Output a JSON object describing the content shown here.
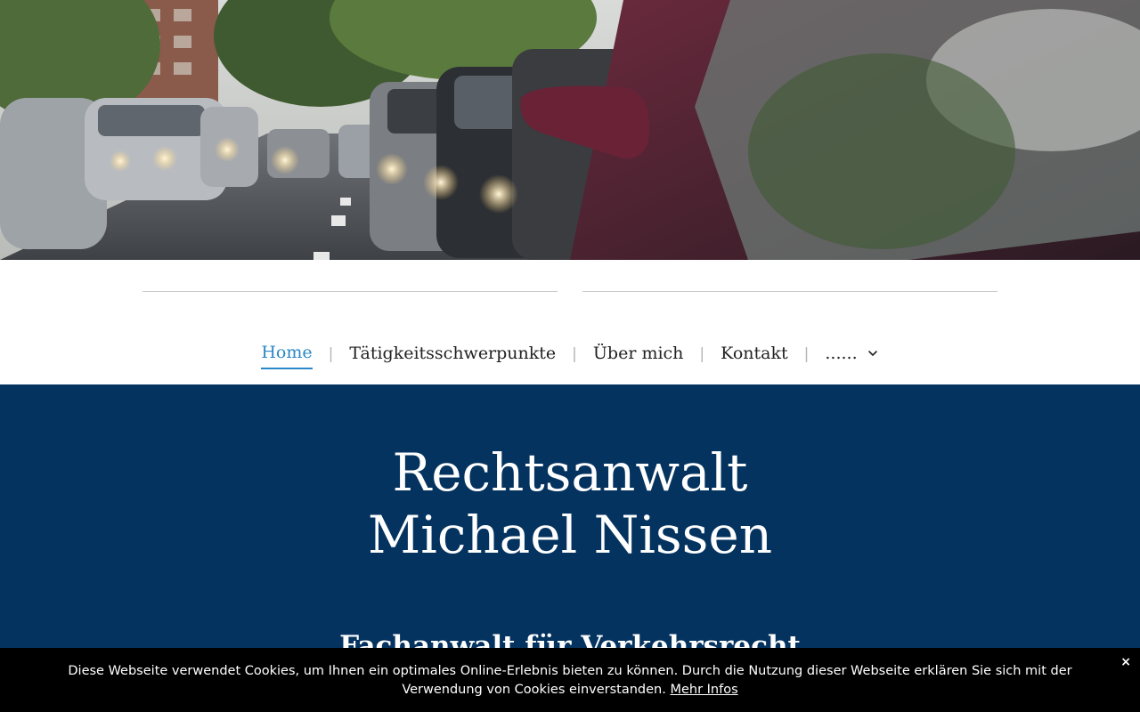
{
  "nav": {
    "items": [
      {
        "label": "Home",
        "active": true
      },
      {
        "label": "Tätigkeitsschwerpunkte"
      },
      {
        "label": "Über mich"
      },
      {
        "label": "Kontakt"
      },
      {
        "label": "......",
        "has_dropdown": true
      }
    ],
    "separator": "|"
  },
  "hero": {
    "title_line1": "Rechtsanwalt",
    "title_line2": "Michael Nissen",
    "subtitle": "Fachanwalt für Verkehrsrecht"
  },
  "cookie_banner": {
    "text": "Diese Webseite verwendet Cookies, um Ihnen ein optimales Online-Erlebnis bieten zu können. Durch die Nutzung dieser Webseite erklären Sie sich mit der Verwendung von Cookies einverstanden.",
    "link_label": "Mehr Infos",
    "close_label": "×"
  },
  "colors": {
    "accent": "#2a87c9",
    "main_background": "#05335f",
    "cookie_background": "#000000"
  }
}
